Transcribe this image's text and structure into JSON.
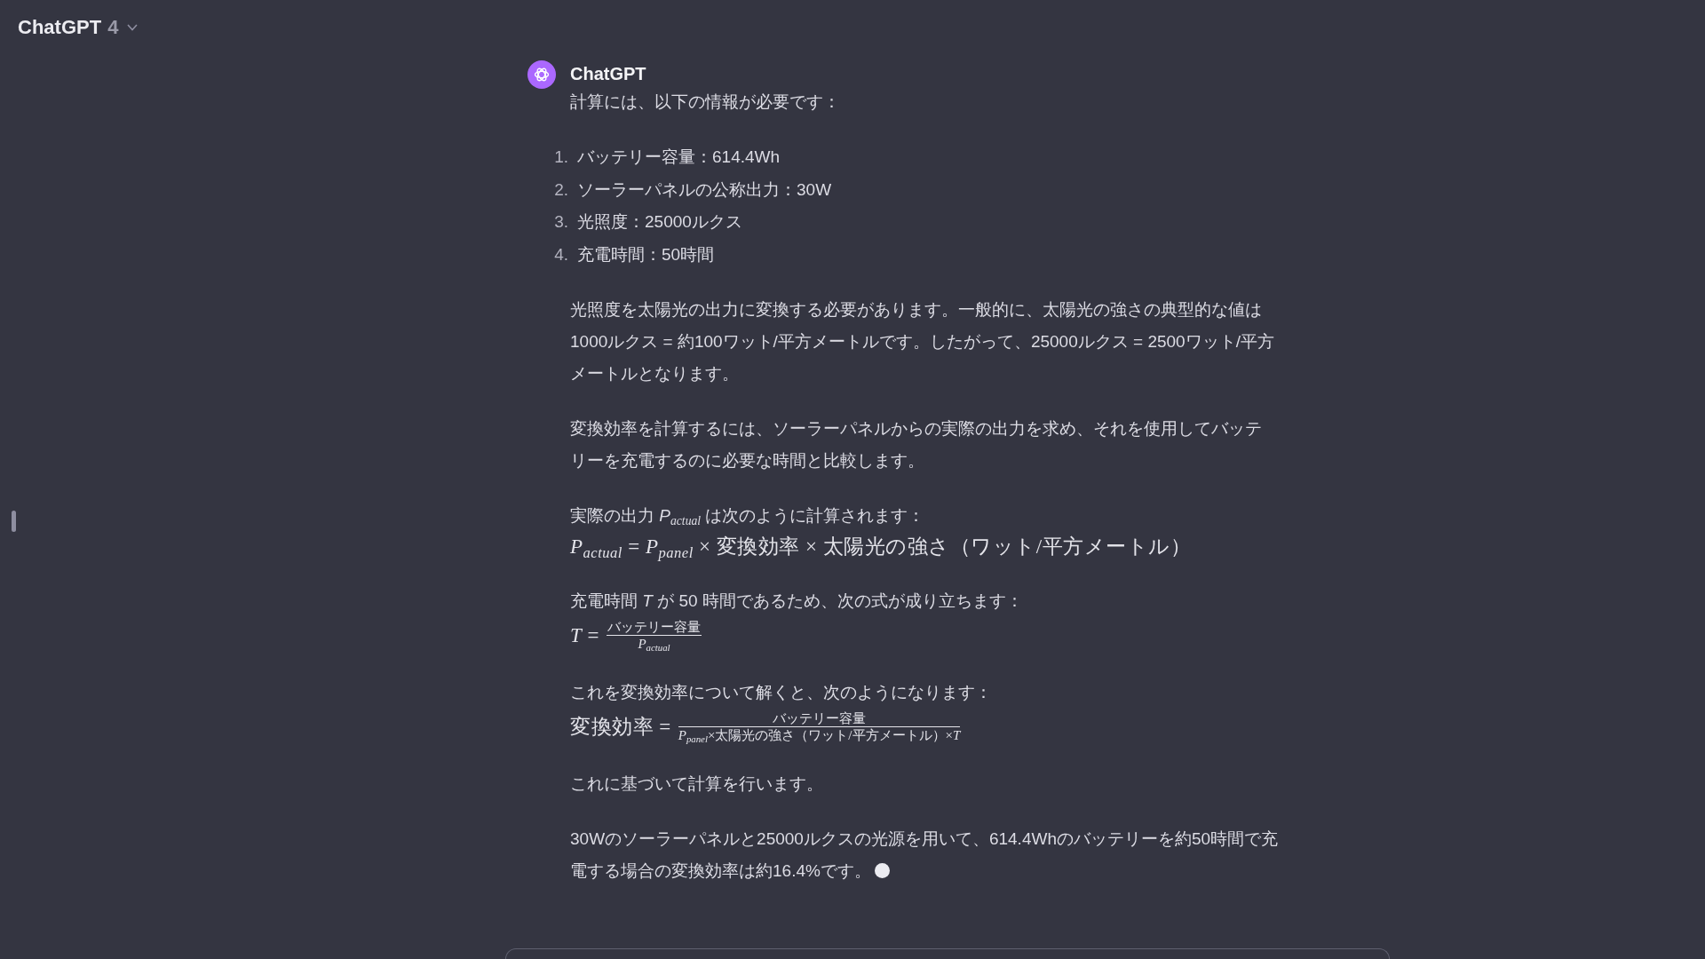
{
  "header": {
    "title": "ChatGPT",
    "version": "4"
  },
  "message": {
    "author": "ChatGPT",
    "streaming": true,
    "blocks": [
      {
        "kind": "paragraph",
        "text": "計算には、以下の情報が必要です："
      },
      {
        "kind": "list",
        "items": [
          {
            "number": "1.",
            "text": "バッテリー容量：614.4Wh"
          },
          {
            "number": "2.",
            "text": "ソーラーパネルの公称出力：30W"
          },
          {
            "number": "3.",
            "text": "光照度：25000ルクス"
          },
          {
            "number": "4.",
            "text": "充電時間：50時間"
          }
        ]
      },
      {
        "kind": "paragraph",
        "text": "光照度を太陽光の出力に変換する必要があります。一般的に、太陽光の強さの典型的な値は1000ルクス = 約100ワット/平方メートルです。したがって、25000ルクス = 2500ワット/平方メートルとなります。"
      },
      {
        "kind": "paragraph",
        "text": "変換効率を計算するには、ソーラーパネルからの実際の出力を求め、それを使用してバッテリーを充電するのに必要な時間と比較します。"
      },
      {
        "kind": "derivation",
        "text": "実際の出力 *P*$_{actual}$ は次のように計算されます：",
        "formula": {
          "kind": "expression",
          "expr": "*P*$_{actual}$ = *P*$_{panel}$ × 変換効率 × 太陽光の強さ（ワット/平方メートル）"
        }
      },
      {
        "kind": "derivation",
        "text": "充電時間 *T* が 50 時間であるため、次の式が成り立ちます：",
        "formula": {
          "kind": "fraction",
          "lhs": "*T* =",
          "numerator": "バッテリー容量",
          "denominator": "*P*$_{actual}$"
        }
      },
      {
        "kind": "derivation",
        "text": "これを変換効率について解くと、次のようになります：",
        "formula": {
          "kind": "fraction",
          "lhs": "変換効率 =",
          "numerator": "バッテリー容量",
          "denominator": "*P*$_{panel}$×太陽光の強さ（ワット/平方メートル）×*T*"
        }
      },
      {
        "kind": "paragraph",
        "text": "これに基づいて計算を行います。"
      },
      {
        "kind": "paragraph",
        "text": "30Wのソーラーパネルと25000ルクスの光源を用いて、614.4Whのバッテリーを約50時間で充電する場合の変換効率は約16.4%です。"
      }
    ]
  }
}
